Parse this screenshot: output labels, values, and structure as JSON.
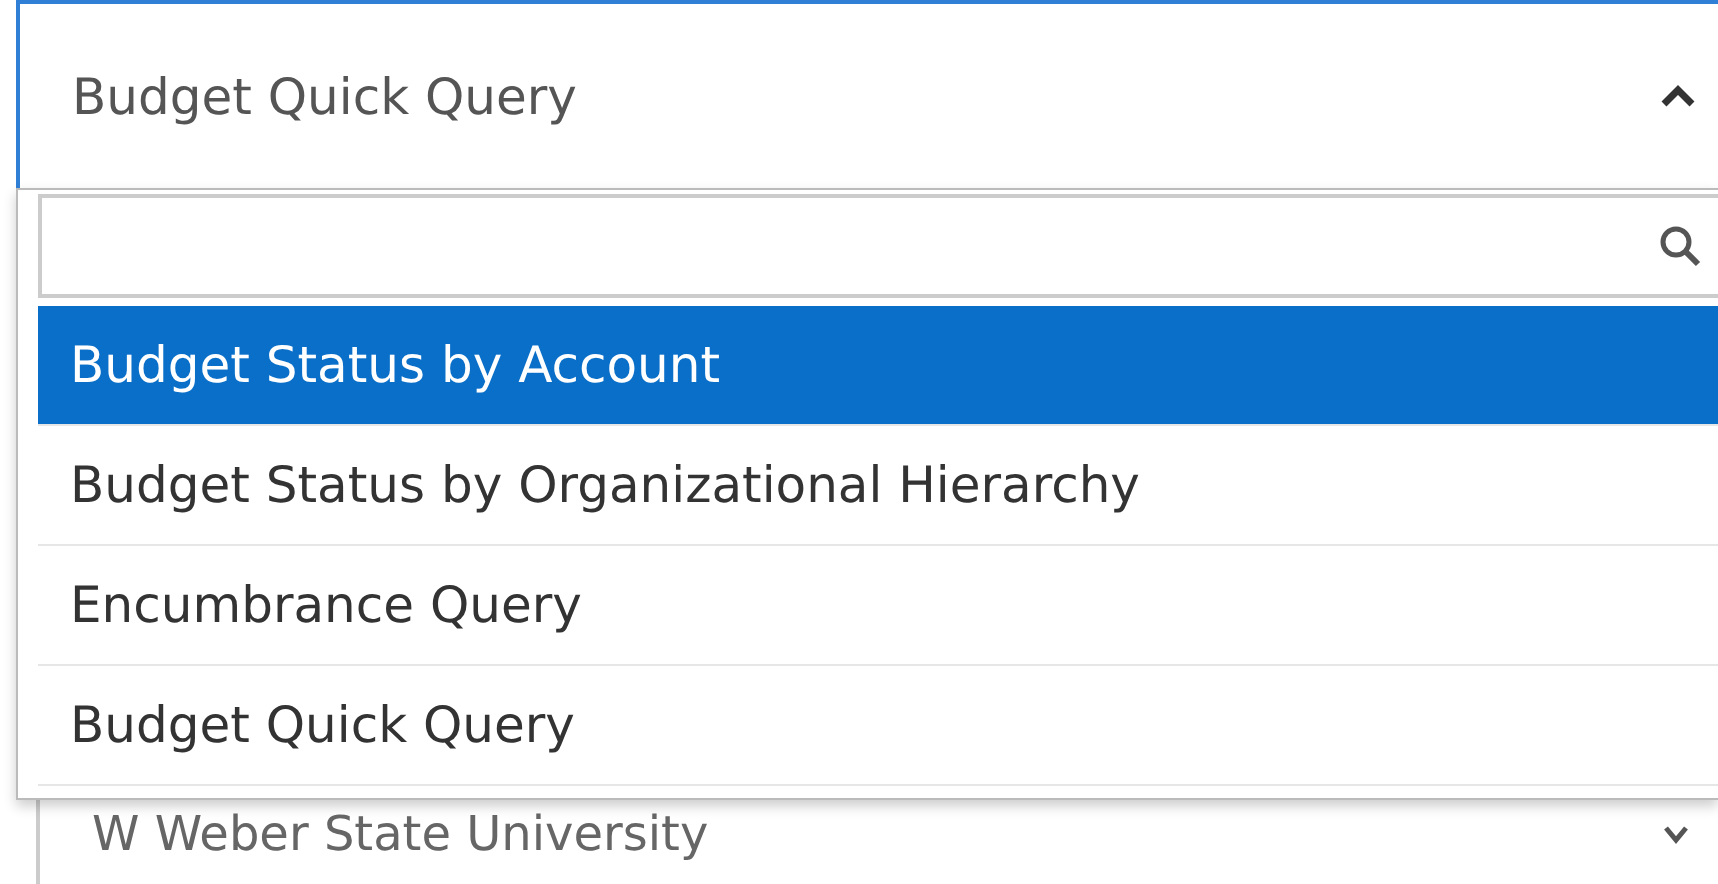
{
  "select": {
    "value": "Budget Quick Query",
    "expanded": true
  },
  "dropdown": {
    "options": [
      {
        "label": "Budget Status by Account",
        "selected": true
      },
      {
        "label": "Budget Status by Organizational Hierarchy",
        "selected": false
      },
      {
        "label": "Encumbrance Query",
        "selected": false
      },
      {
        "label": "Budget Quick Query",
        "selected": false
      }
    ]
  },
  "next_select": {
    "value": "W Weber State University"
  }
}
